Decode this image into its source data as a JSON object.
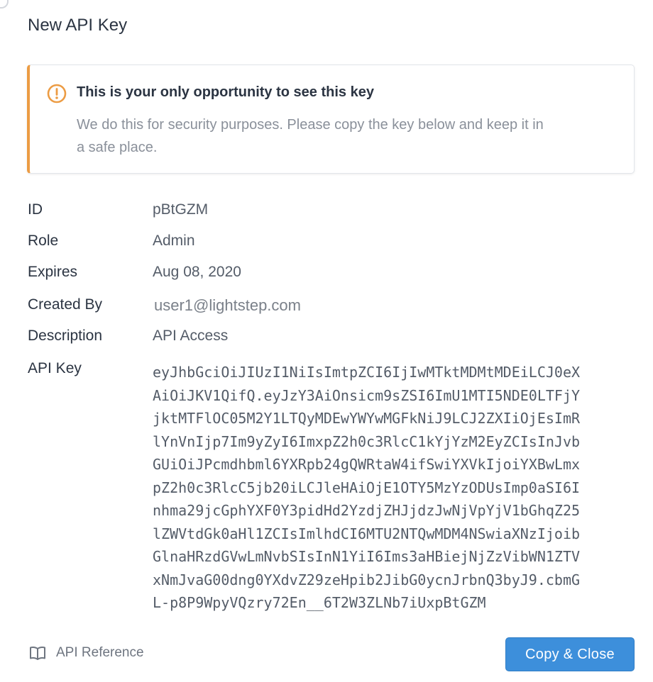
{
  "colors": {
    "accent": "#3d8fdb",
    "warning": "#ec9c44",
    "text": "#2b3442",
    "muted": "#8a909a"
  },
  "dialog": {
    "title": "New API Key"
  },
  "warning": {
    "icon": "alert-circle-icon",
    "title": "This is your only opportunity to see this key",
    "body": "We do this for security purposes. Please copy the key below and keep it in a safe place."
  },
  "details": {
    "id": {
      "label": "ID",
      "value": "pBtGZM"
    },
    "role": {
      "label": "Role",
      "value": "Admin"
    },
    "expires": {
      "label": "Expires",
      "value": "Aug 08, 2020"
    },
    "created_by": {
      "label": "Created By",
      "value": "user1@lightstep.com"
    },
    "description": {
      "label": "Description",
      "value": "API Access"
    },
    "api_key": {
      "label": "API Key",
      "lines": [
        "eyJhbGciOiJIUzI1NiIsImtpZCI6IjIwMTktMDMtMDEiLCJ0eX",
        "AiOiJKV1QifQ.eyJzY3AiOnsicm9sZSI6ImU1MTI5NDE0LTFjY",
        "jktMTFlOC05M2Y1LTQyMDEwYWYwMGFkNiJ9LCJ2ZXIiOjEsImR",
        "lYnVnIjp7Im9yZyI6ImxpZ2h0c3RlcC1kYjYzM2EyZCIsInJvb",
        "GUiOiJPcmdhbml6YXRpb24gQWRtaW4ifSwiYXVkIjoiYXBwLmx",
        "pZ2h0c3RlcC5jb20iLCJleHAiOjE1OTY5MzYzODUsImp0aSI6I",
        "nhma29jcGphYXF0Y3pidHd2YzdjZHJjdzJwNjVpYjV1bGhqZ25",
        "lZWVtdGk0aHl1ZCIsImlhdCI6MTU2NTQwMDM4NSwiaXNzIjoib",
        "GlnaHRzdGVwLmNvbSIsInN1YiI6Ims3aHBiejNjZzVibWN1ZTV",
        "xNmJvaG00dng0YXdvZ29zeHpib2JibG0ycnJrbnQ3byJ9.cbmG",
        "L-p8P9WpyVQzry72En__6T2W3ZLNb7iUxpBtGZM"
      ]
    }
  },
  "footer": {
    "link_icon": "book-icon",
    "link_label": "API Reference",
    "button_label": "Copy & Close"
  }
}
